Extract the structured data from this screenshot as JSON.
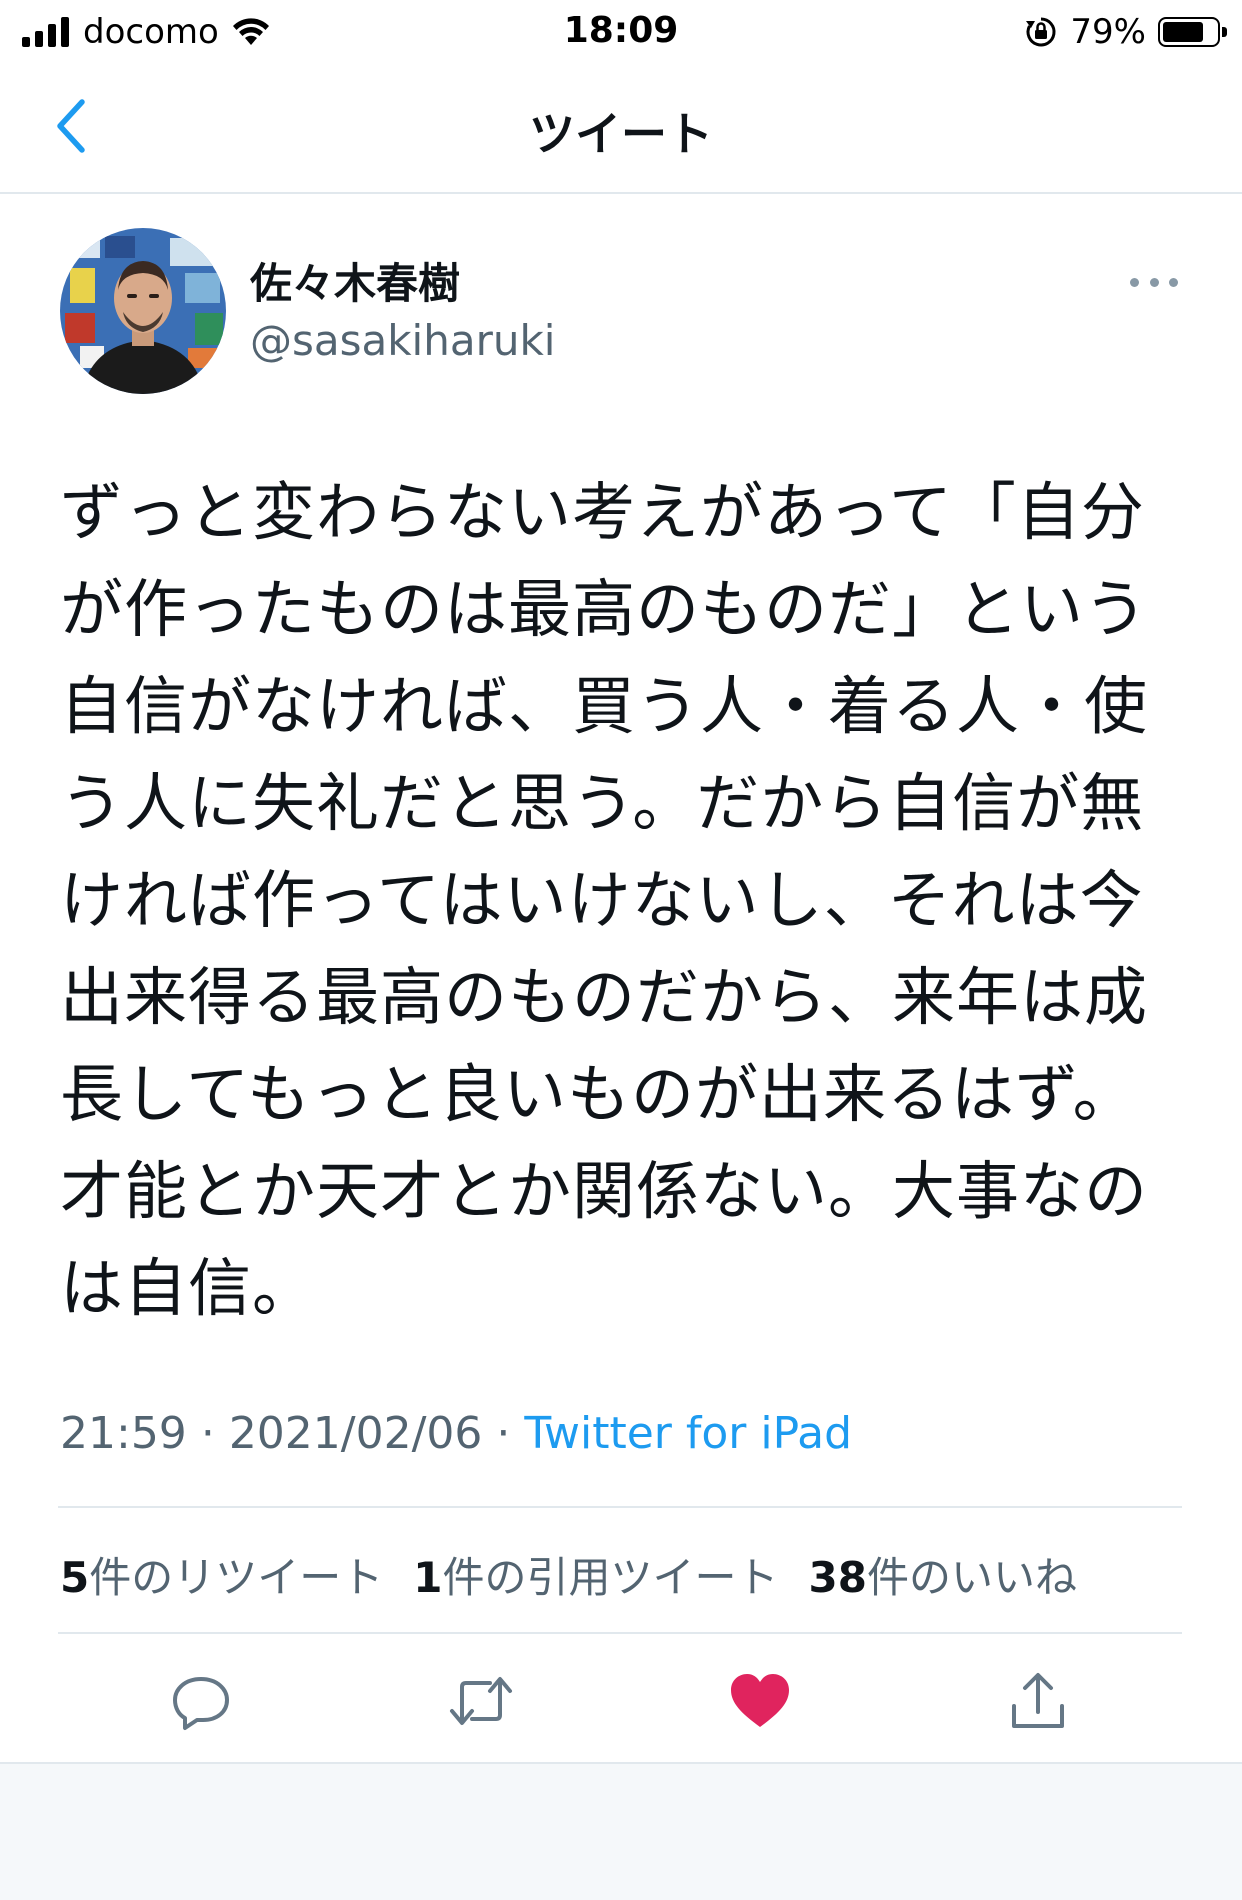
{
  "status_bar": {
    "carrier": "docomo",
    "time": "18:09",
    "battery": "79%",
    "battery_level": 0.79,
    "icons": [
      "signal-icon",
      "wifi-icon",
      "rotation-lock-icon",
      "battery-icon"
    ]
  },
  "nav": {
    "title": "ツイート",
    "back_icon": "chevron-left-icon"
  },
  "author": {
    "name": "佐々木春樹",
    "handle": "@sasakiharuki"
  },
  "tweet": {
    "lines": [
      "ずっと変わらない考えがあって「自分",
      "が作ったものは最高のものだ」という",
      "自信がなければ、買う人・着る人・使",
      "う人に失礼だと思う。だから自信が無",
      "ければ作ってはいけないし、それは今",
      "出来得る最高のものだから、来年は成",
      "長してもっと良いものが出来るはず。",
      "才能とか天才とか関係ない。大事なの",
      "は自信。"
    ],
    "time": "21:59",
    "date": "2021/02/06",
    "separator": "·",
    "source": "Twitter for iPad"
  },
  "stats": {
    "retweets_count": "5",
    "retweets_label": "件のリツイート",
    "quotes_count": "1",
    "quotes_label": "件の引用ツイート",
    "likes_count": "38",
    "likes_label": "件のいいね"
  },
  "actions": {
    "icons": [
      "reply-icon",
      "retweet-icon",
      "like-icon",
      "share-icon"
    ],
    "like_color": "#e0245e",
    "icon_color": "#657786"
  },
  "colors": {
    "accent": "#1d9bf0",
    "secondary_text": "#536471",
    "like": "#e0245e"
  }
}
